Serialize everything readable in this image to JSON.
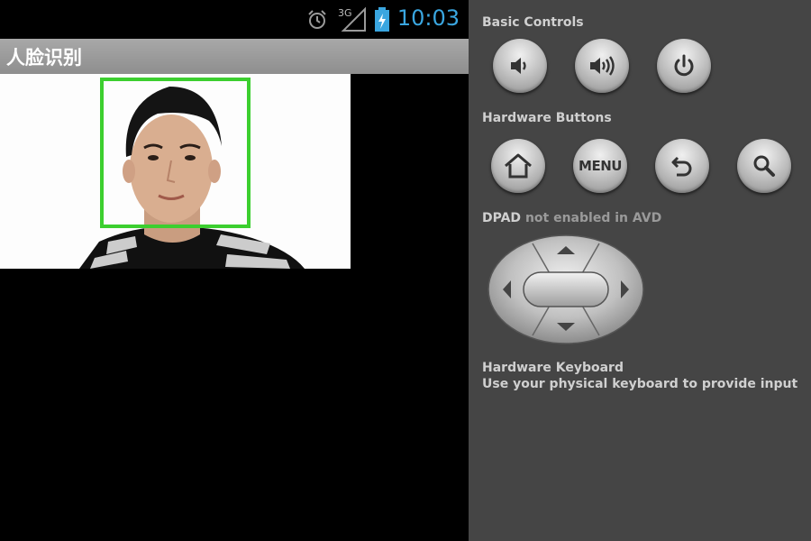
{
  "status_bar": {
    "time": "10:03",
    "network_label": "3G",
    "icons": [
      "alarm-clock-icon",
      "signal-icon",
      "battery-charging-icon"
    ]
  },
  "app": {
    "title": "人脸识别"
  },
  "detection_box_color": "#3ccf2f",
  "controls": {
    "basic_label": "Basic Controls",
    "basic_buttons": [
      "volume-down-icon",
      "volume-up-icon",
      "power-icon"
    ],
    "hardware_label": "Hardware Buttons",
    "hardware_buttons": [
      "home-icon",
      "menu-button",
      "back-icon",
      "search-icon"
    ],
    "menu_label": "MENU",
    "dpad_label": "DPAD",
    "dpad_status": "not enabled in AVD",
    "keyboard_title": "Hardware Keyboard",
    "keyboard_desc": "Use your physical keyboard to provide input"
  }
}
